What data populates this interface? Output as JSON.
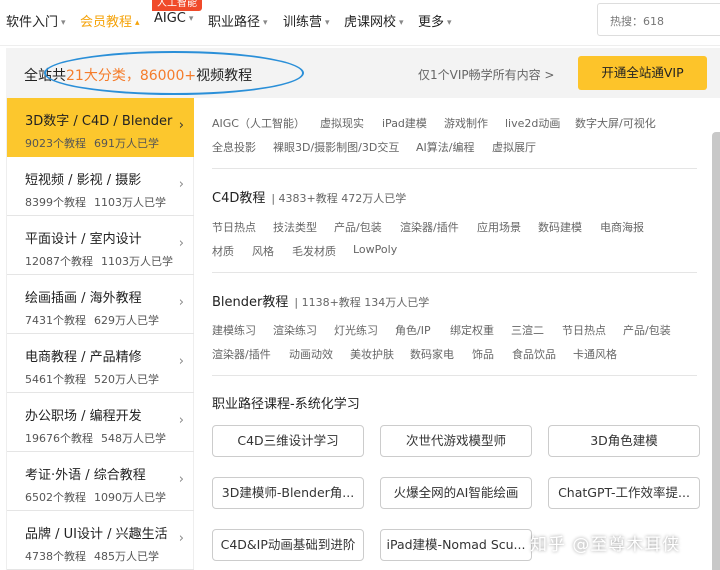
{
  "nav": {
    "items": [
      "软件入门",
      "会员教程",
      "AIGC",
      "职业路径",
      "训练营",
      "虎课网校",
      "更多"
    ],
    "aigc_badge": "人工智能",
    "hot_search": "热搜：618",
    "active_color": "#f5a30a"
  },
  "banner": {
    "prefix": "全站共",
    "highlight": "21大分类，86000+",
    "suffix": "视频教程",
    "vip_text": "仅1个VIP畅学所有内容 >",
    "vip_button": "开通全站通VIP"
  },
  "sidebar": [
    {
      "title": "3D数字 / C4D / Blender",
      "courses": "9023个教程",
      "learners": "691万人已学"
    },
    {
      "title": "短视频 / 影视 / 摄影",
      "courses": "8399个教程",
      "learners": "1103万人已学"
    },
    {
      "title": "平面设计 / 室内设计",
      "courses": "12087个教程",
      "learners": "1103万人已学"
    },
    {
      "title": "绘画插画 / 海外教程",
      "courses": "7431个教程",
      "learners": "629万人已学"
    },
    {
      "title": "电商教程 / 产品精修",
      "courses": "5461个教程",
      "learners": "520万人已学"
    },
    {
      "title": "办公职场 / 编程开发",
      "courses": "19676个教程",
      "learners": "548万人已学"
    },
    {
      "title": "考证·外语 / 综合教程",
      "courses": "6502个教程",
      "learners": "1090万人已学"
    },
    {
      "title": "品牌 / UI设计 / 兴趣生活",
      "courses": "4738个教程",
      "learners": "485万人已学"
    }
  ],
  "content": {
    "top_tags": [
      "AIGC（人工智能）",
      "虚拟现实",
      "iPad建模",
      "游戏制作",
      "live2d动画",
      "数字大屏/可视化",
      "全息投影",
      "裸眼3D/摄影制图/3D交互",
      "AI算法/编程",
      "虚拟展厅"
    ],
    "c4d": {
      "title": "C4D教程",
      "stats": "| 4383+教程 472万人已学",
      "tags": [
        "节日热点",
        "技法类型",
        "产品/包装",
        "渲染器/插件",
        "应用场景",
        "数码建模",
        "电商海报",
        "材质",
        "风格",
        "毛发材质",
        "LowPoly"
      ]
    },
    "blender": {
      "title": "Blender教程",
      "stats": "| 1138+教程 134万人已学",
      "tags": [
        "建模练习",
        "渲染练习",
        "灯光练习",
        "角色/IP",
        "绑定权重",
        "三渲二",
        "节日热点",
        "产品/包装",
        "渲染器/插件",
        "动画动效",
        "美妆护肤",
        "数码家电",
        "饰品",
        "食品饮品",
        "卡通风格"
      ]
    },
    "career": {
      "title": "职业路径课程-系统化学习",
      "cards": [
        "C4D三维设计学习",
        "次世代游戏模型师",
        "3D角色建模",
        "3D建模师-Blender角...",
        "火爆全网的AI智能绘画",
        "ChatGPT-工作效率提...",
        "C4D&IP动画基础到进阶",
        "iPad建模-Nomad Scu..."
      ]
    }
  },
  "watermark": "知乎 @至尊木耳侠"
}
